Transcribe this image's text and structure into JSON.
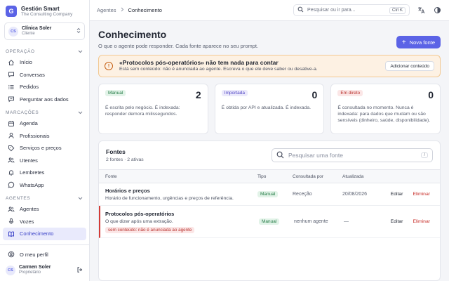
{
  "brand": {
    "name": "Gestión Smart",
    "subtitle": "The Consulting Company",
    "logo_letter": "G"
  },
  "org": {
    "initials": "CS",
    "name": "Clínica Soler",
    "role": "Cliente"
  },
  "sidebar": {
    "sections": [
      {
        "label": "Operação",
        "items": [
          {
            "label": "Início",
            "icon": "home-icon"
          },
          {
            "label": "Conversas",
            "icon": "chat-icon"
          },
          {
            "label": "Pedidos",
            "icon": "list-icon"
          },
          {
            "label": "Perguntar aos dados",
            "icon": "chat-question-icon"
          }
        ]
      },
      {
        "label": "Marcações",
        "items": [
          {
            "label": "Agenda",
            "icon": "calendar-icon"
          },
          {
            "label": "Profissionais",
            "icon": "user-icon"
          },
          {
            "label": "Serviços e preços",
            "icon": "tag-icon"
          },
          {
            "label": "Utentes",
            "icon": "users-icon"
          },
          {
            "label": "Lembretes",
            "icon": "bell-icon"
          },
          {
            "label": "WhatsApp",
            "icon": "whatsapp-icon"
          }
        ]
      },
      {
        "label": "Agentes",
        "items": [
          {
            "label": "Agentes",
            "icon": "users-icon"
          },
          {
            "label": "Vozes",
            "icon": "microphone-icon"
          },
          {
            "label": "Conhecimento",
            "icon": "book-icon",
            "active": true
          }
        ]
      }
    ],
    "profile_link": "O meu perfil",
    "user": {
      "initials": "CS",
      "name": "Carmen Soler",
      "role": "Proprietário"
    }
  },
  "topbar": {
    "breadcrumb": [
      "Agentes",
      "Conhecimento"
    ],
    "search_placeholder": "Pesquisar ou ir para...",
    "search_shortcut": "Ctrl K"
  },
  "page": {
    "title": "Conhecimento",
    "subtitle": "O que o agente pode responder. Cada fonte aparece no seu prompt.",
    "new_button": "Nova fonte"
  },
  "warning": {
    "title": "«Protocolos pós-operatórios» não tem nada para contar",
    "description": "Está sem conteúdo: não é anunciada ao agente. Escreva o que ele deve saber ou desative-a.",
    "button": "Adicionar conteúdo"
  },
  "cards": [
    {
      "badge": "Manual",
      "count": "2",
      "description": "É escrita pelo negócio. É indexada: responder demora milissegundos.",
      "color": "#227a44"
    },
    {
      "badge": "Importada",
      "count": "0",
      "description": "É obtida por API e atualizada. É indexada.",
      "color": "#5046c4"
    },
    {
      "badge": "Em direto",
      "count": "0",
      "description": "É consultada no momento. Nunca é indexada: para dados que mudam ou são sensíveis (dinheiro, saúde, disponibilidade).",
      "color": "#b8322e"
    }
  ],
  "sources": {
    "title": "Fontes",
    "summary": "2 fontes · 2 ativas",
    "search_placeholder": "Pesquisar uma fonte",
    "search_shortcut": "/",
    "columns": {
      "fonte": "Fonte",
      "tipo": "Tipo",
      "consultada": "Consultada por",
      "atualizada": "Atualizada"
    },
    "rows": [
      {
        "title": "Horários e preços",
        "description": "Horário de funcionamento, urgências e preços de referência.",
        "tipo": "Manual",
        "consultada": "Receção",
        "atualizada": "20/08/2026",
        "edit": "Editar",
        "delete": "Eliminar"
      },
      {
        "title": "Protocolos pós-operatórios",
        "description": "O que dizer após uma extração.",
        "flag": "sem conteúdo: não é anunciada ao agente",
        "tipo": "Manual",
        "consultada": "nenhum agente",
        "atualizada": "—",
        "edit": "Editar",
        "delete": "Eliminar"
      }
    ]
  }
}
